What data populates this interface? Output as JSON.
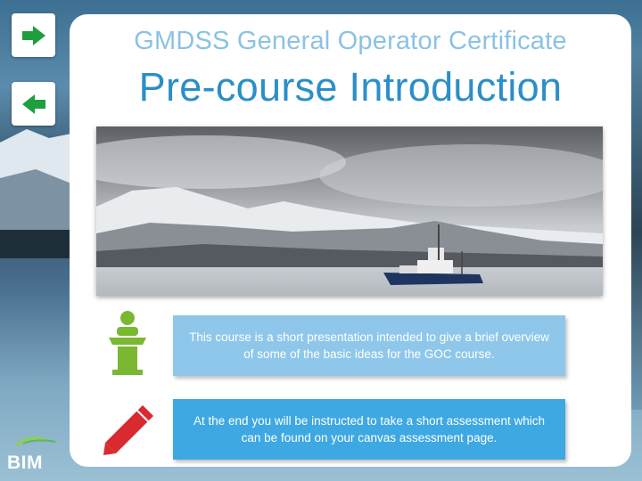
{
  "header": {
    "subtitle": "GMDSS General Operator Certificate",
    "title": "Pre-course Introduction"
  },
  "nav": {
    "next_icon": "arrow-right-icon",
    "back_icon": "arrow-left-icon",
    "accent_color": "#1e9e3e"
  },
  "photo": {
    "subject": "ship-in-arctic-fjord-photo"
  },
  "info_boxes": [
    {
      "icon": "podium-icon",
      "text": "This course is a short presentation intended to give a brief overview of some of the basic ideas for the GOC course.",
      "color": "#8ec7ea"
    },
    {
      "icon": "pencil-icon",
      "text": "At the end you will be instructed to take a short assessment which can be found on your canvas assessment page.",
      "color": "#3da8e1"
    }
  ],
  "logo": {
    "text": "BIM"
  },
  "colors": {
    "subtitle": "#8cc2e3",
    "title": "#2b8fc7",
    "podium": "#7ab832",
    "pencil": "#d92a2f"
  }
}
